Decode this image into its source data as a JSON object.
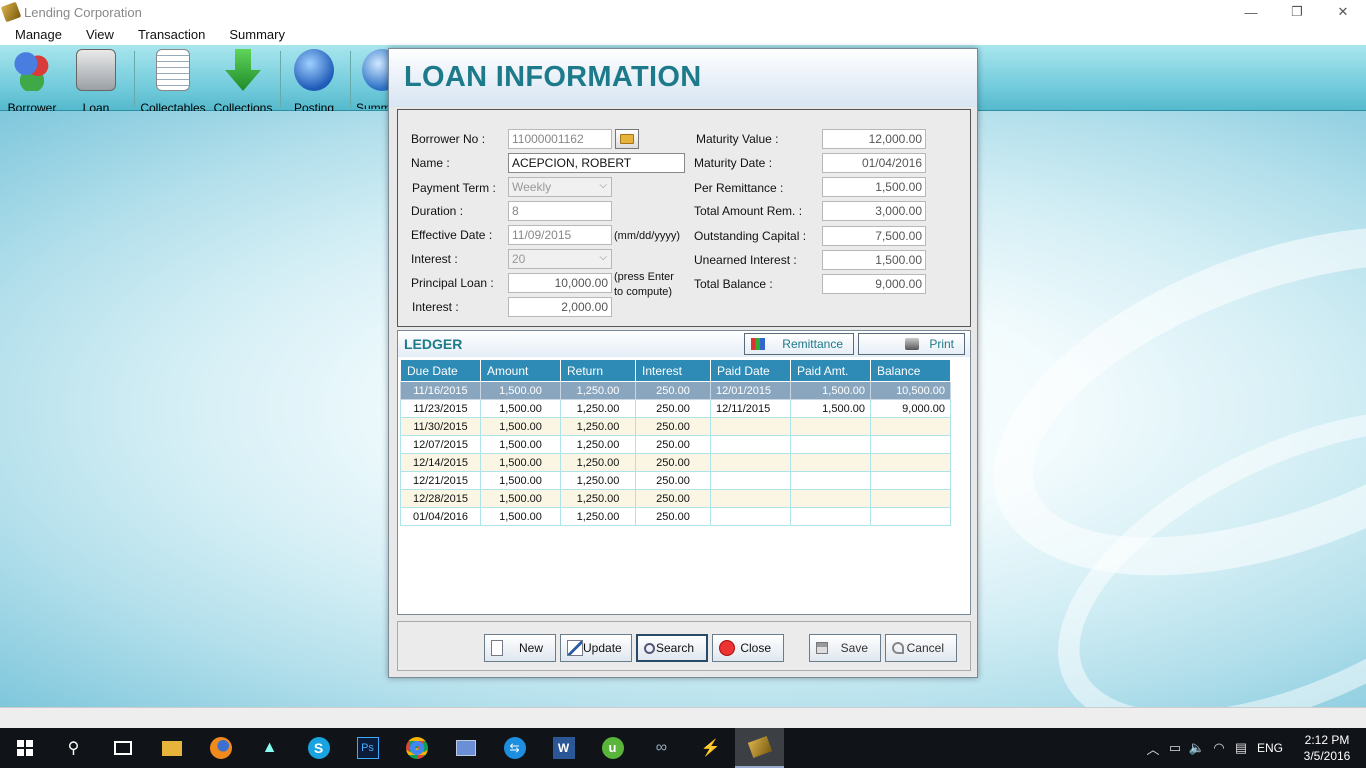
{
  "window": {
    "title": "Lending Corporation",
    "min_glyph": "—",
    "max_glyph": "❐",
    "close_glyph": "✕"
  },
  "menu": [
    "Manage",
    "View",
    "Transaction",
    "Summary"
  ],
  "toolbar": [
    "Borrower",
    "Loan",
    "Collectables",
    "Collections",
    "Posting",
    "Summ"
  ],
  "dialog": {
    "title": "LOAN INFORMATION",
    "left": {
      "borrower_no_label": "Borrower No :",
      "borrower_no": "11000001162",
      "name_label": "Name :",
      "name": "ACEPCION, ROBERT",
      "payment_term_label": "Payment Term :",
      "payment_term": "Weekly",
      "duration_label": "Duration :",
      "duration": "8",
      "effective_date_label": "Effective Date :",
      "effective_date": "11/09/2015",
      "date_hint": "(mm/dd/yyyy)",
      "interest_rate_label": "Interest :",
      "interest_rate": "20",
      "principal_label": "Principal Loan :",
      "principal": "10,000.00",
      "compute_hint_1": "(press Enter",
      "compute_hint_2": "to compute)",
      "interest_label": "Interest :",
      "interest": "2,000.00"
    },
    "right": {
      "maturity_value_label": "Maturity Value :",
      "maturity_value": "12,000.00",
      "maturity_date_label": "Maturity Date :",
      "maturity_date": "01/04/2016",
      "per_remittance_label": "Per Remittance :",
      "per_remittance": "1,500.00",
      "total_rem_label": "Total Amount Rem. :",
      "total_rem": "3,000.00",
      "outstanding_label": "Outstanding Capital :",
      "outstanding": "7,500.00",
      "unearned_label": "Unearned Interest :",
      "unearned": "1,500.00",
      "total_balance_label": "Total Balance :",
      "total_balance": "9,000.00"
    },
    "ledger": {
      "title": "LEDGER",
      "remittance_button": "Remittance",
      "print_button": "Print",
      "columns": [
        "Due Date",
        "Amount",
        "Return",
        "Interest",
        "Paid Date",
        "Paid Amt.",
        "Balance"
      ],
      "rows": [
        [
          "11/16/2015",
          "1,500.00",
          "1,250.00",
          "250.00",
          "12/01/2015",
          "1,500.00",
          "10,500.00"
        ],
        [
          "11/23/2015",
          "1,500.00",
          "1,250.00",
          "250.00",
          "12/11/2015",
          "1,500.00",
          "9,000.00"
        ],
        [
          "11/30/2015",
          "1,500.00",
          "1,250.00",
          "250.00",
          "",
          "",
          ""
        ],
        [
          "12/07/2015",
          "1,500.00",
          "1,250.00",
          "250.00",
          "",
          "",
          ""
        ],
        [
          "12/14/2015",
          "1,500.00",
          "1,250.00",
          "250.00",
          "",
          "",
          ""
        ],
        [
          "12/21/2015",
          "1,500.00",
          "1,250.00",
          "250.00",
          "",
          "",
          ""
        ],
        [
          "12/28/2015",
          "1,500.00",
          "1,250.00",
          "250.00",
          "",
          "",
          ""
        ],
        [
          "01/04/2016",
          "1,500.00",
          "1,250.00",
          "250.00",
          "",
          "",
          ""
        ]
      ]
    },
    "buttons": [
      "New",
      "Update",
      "Search",
      "Close",
      "Save",
      "Cancel"
    ]
  },
  "taskbar": {
    "language": "ENG",
    "time": "2:12 PM",
    "date": "3/5/2016"
  },
  "colors": {
    "accent": "#1d7a8a",
    "grid_header": "#2d8bb5",
    "selected_row": "#8aa6bf",
    "toolbar": "#6ec9da"
  }
}
